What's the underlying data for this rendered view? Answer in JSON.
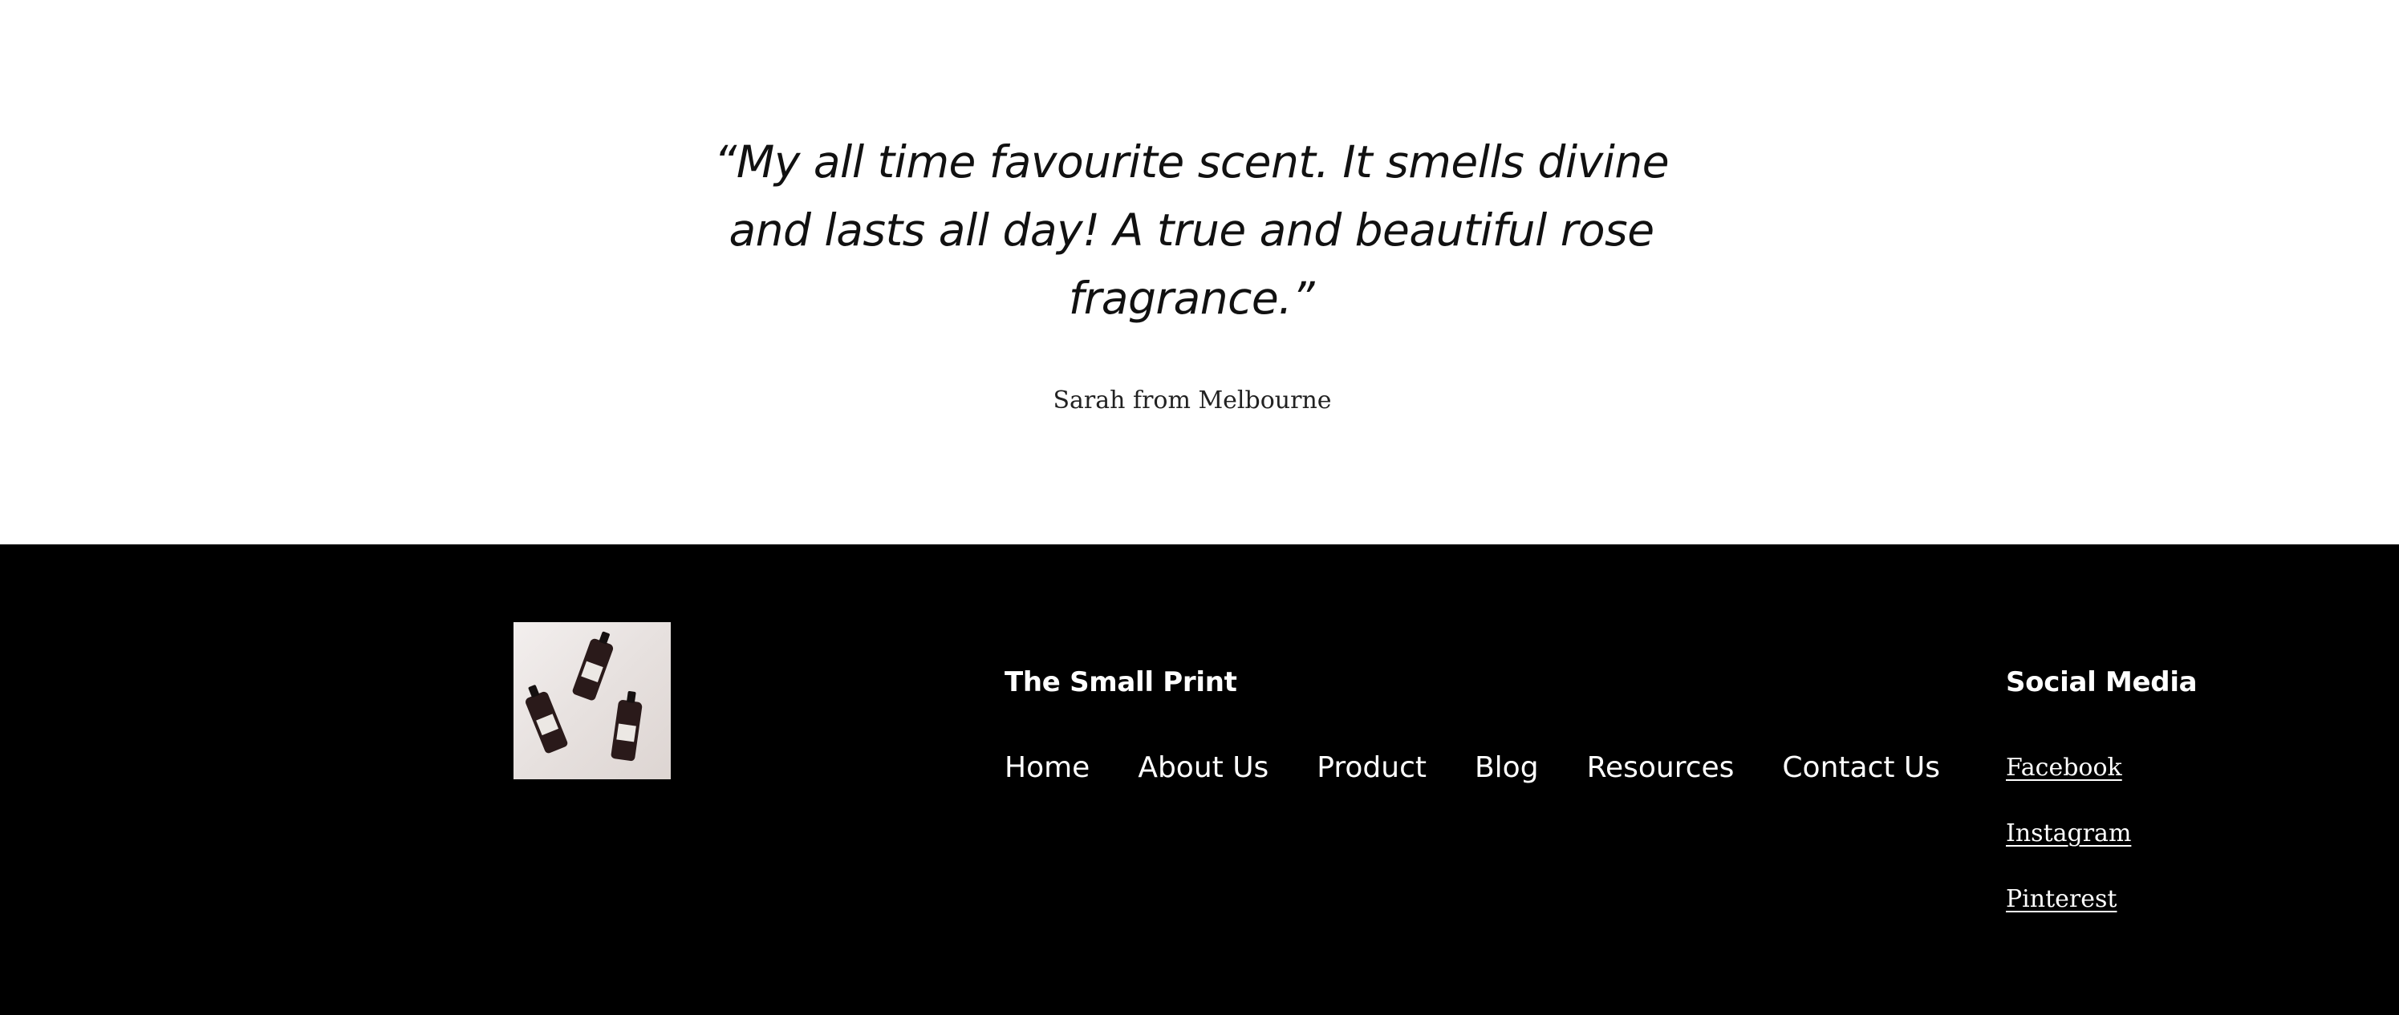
{
  "testimonial": {
    "quote": "“My all time favourite scent. It smells divine and lasts all day! A true and beautiful rose fragrance.”",
    "author": "Sarah from Melbourne"
  },
  "footer": {
    "logo_icon": "product-bottles-image",
    "small_print": {
      "title": "The Small Print",
      "links": [
        {
          "label": "Home"
        },
        {
          "label": "About Us"
        },
        {
          "label": "Product"
        },
        {
          "label": "Blog"
        },
        {
          "label": "Resources"
        },
        {
          "label": "Contact Us"
        }
      ]
    },
    "social": {
      "title": "Social Media",
      "links": [
        {
          "label": "Facebook"
        },
        {
          "label": "Instagram"
        },
        {
          "label": "Pinterest"
        }
      ]
    }
  },
  "colors": {
    "background": "#ffffff",
    "footer_background": "#000000",
    "footer_text": "#ffffff",
    "body_text": "#111111"
  }
}
